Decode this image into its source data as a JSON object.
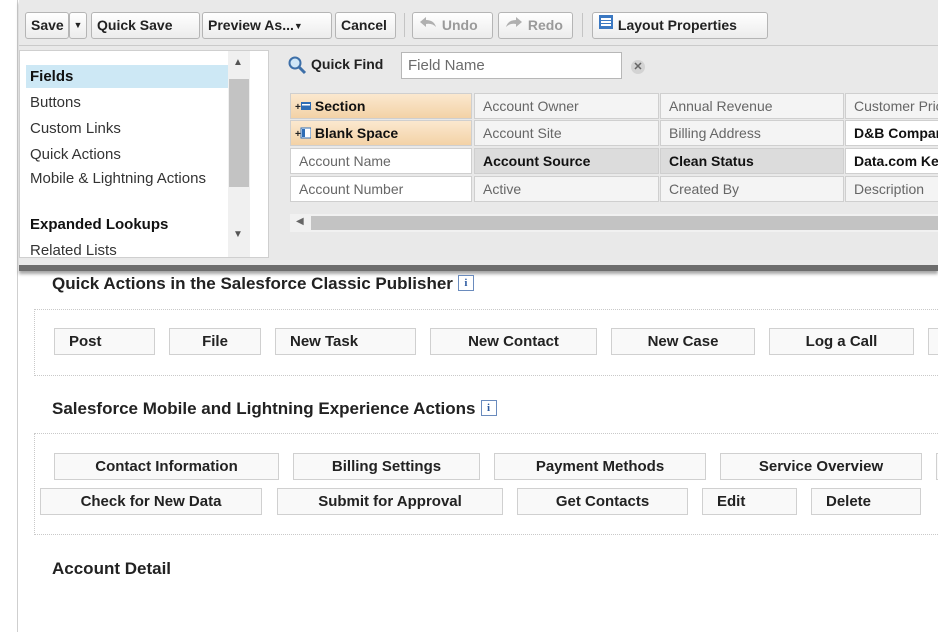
{
  "toolbar": {
    "save": "Save",
    "quick_save": "Quick Save",
    "preview_as": "Preview As...",
    "cancel": "Cancel",
    "undo": "Undo",
    "redo": "Redo",
    "layout_properties": "Layout Properties"
  },
  "categories": [
    "Fields",
    "Buttons",
    "Custom Links",
    "Quick Actions",
    "Mobile & Lightning Actions",
    "Expanded Lookups",
    "Related Lists"
  ],
  "selected_category": "Fields",
  "quick_find": {
    "label": "Quick Find",
    "placeholder": "Field Name"
  },
  "fields_grid": [
    [
      "Section",
      "Account Owner",
      "Annual Revenue",
      "Customer Priority"
    ],
    [
      "Blank Space",
      "Account Site",
      "Billing Address",
      "D&B Company"
    ],
    [
      "Account Name",
      "Account Source",
      "Clean Status",
      "Data.com Key"
    ],
    [
      "Account Number",
      "Active",
      "Created By",
      "Description"
    ]
  ],
  "classic_publisher": {
    "title": "Quick Actions in the Salesforce Classic Publisher",
    "actions": [
      "Post",
      "File",
      "New Task",
      "New Contact",
      "New Case",
      "Log a Call"
    ]
  },
  "mobile_actions": {
    "title": "Salesforce Mobile and Lightning Experience Actions",
    "row1": [
      "Contact Information",
      "Billing Settings",
      "Payment Methods",
      "Service Overview"
    ],
    "row2": [
      "Check for New Data",
      "Submit for Approval",
      "Get Contacts",
      "Edit",
      "Delete"
    ]
  },
  "account_detail": {
    "title": "Account Detail"
  },
  "colors": {
    "selected_category": "#cde8f5",
    "special_field": "#f3d2a6",
    "used_field": "#dcdcdc",
    "panel_border": "#6d6d6d"
  }
}
